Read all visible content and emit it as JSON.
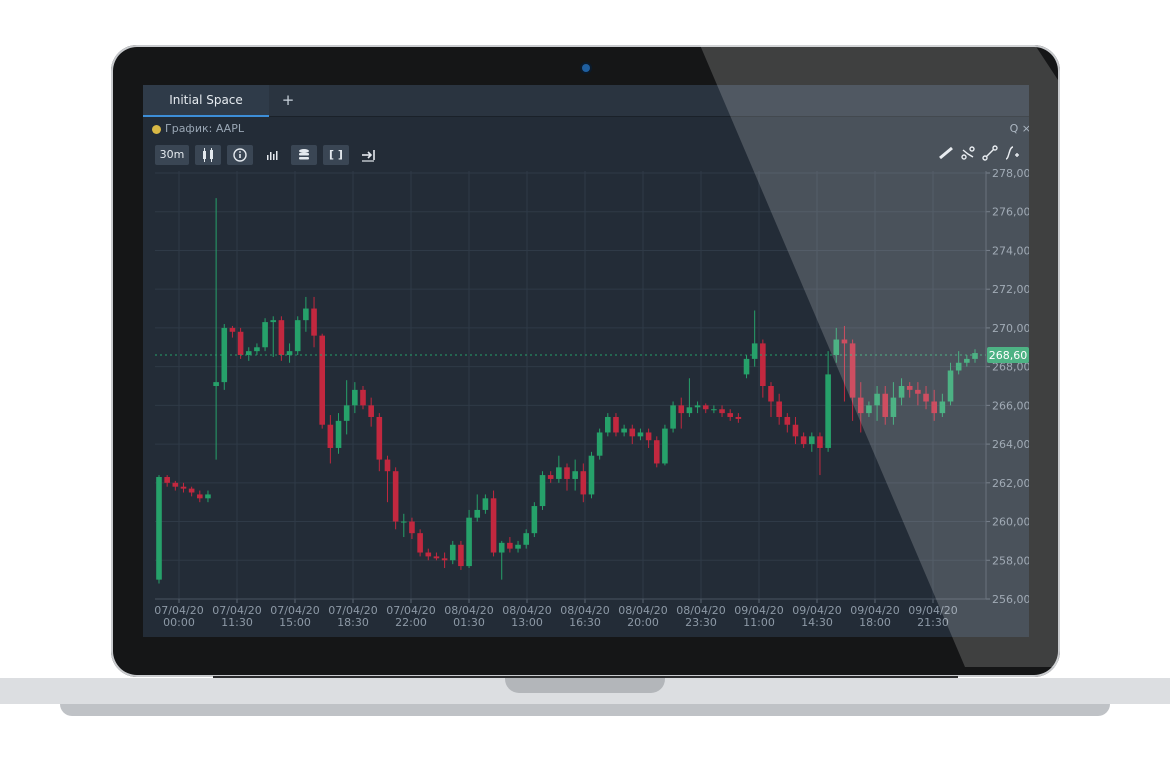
{
  "app": {
    "tabs": [
      {
        "label": "Initial Space"
      }
    ],
    "add_tab": "+",
    "chart_title": "График: AAPL",
    "title_tools": "Q ×",
    "toolbar": {
      "timeframe": "30m",
      "buttons": [
        "candles-icon",
        "info-icon",
        "volume-icon",
        "layers-icon",
        "brackets-icon",
        "arrow-right-bar-icon"
      ],
      "brackets_label": "[ ]"
    },
    "right_tools": [
      "ruler-icon",
      "fib-icon",
      "trend-line-icon",
      "indicator-add-icon"
    ],
    "colors": {
      "up": "#26a16a",
      "down": "#c2283f",
      "bg": "#232c37",
      "price_tag": "#26a16a"
    }
  },
  "chart_data": {
    "type": "candlestick",
    "symbol": "AAPL",
    "title": "График: AAPL",
    "ylim": [
      256,
      278
    ],
    "y_ticks": [
      "278,00",
      "276,00",
      "274,00",
      "272,00",
      "270,00",
      "268,00",
      "266,00",
      "264,00",
      "262,00",
      "260,00",
      "258,00",
      "256,00"
    ],
    "last_price": "268,60",
    "x_ticks": [
      {
        "date": "07/04/20",
        "time": "00:00"
      },
      {
        "date": "07/04/20",
        "time": "11:30"
      },
      {
        "date": "07/04/20",
        "time": "15:00"
      },
      {
        "date": "07/04/20",
        "time": "18:30"
      },
      {
        "date": "07/04/20",
        "time": "22:00"
      },
      {
        "date": "08/04/20",
        "time": "01:30"
      },
      {
        "date": "08/04/20",
        "time": "13:00"
      },
      {
        "date": "08/04/20",
        "time": "16:30"
      },
      {
        "date": "08/04/20",
        "time": "20:00"
      },
      {
        "date": "08/04/20",
        "time": "23:30"
      },
      {
        "date": "09/04/20",
        "time": "11:00"
      },
      {
        "date": "09/04/20",
        "time": "14:30"
      },
      {
        "date": "09/04/20",
        "time": "18:00"
      },
      {
        "date": "09/04/20",
        "time": "21:30"
      }
    ],
    "candles": [
      [
        257,
        262.3,
        256.8,
        262.4
      ],
      [
        262.3,
        262,
        261.8,
        262.4
      ],
      [
        262,
        261.8,
        261.6,
        262.1
      ],
      [
        261.8,
        261.7,
        261.5,
        262
      ],
      [
        261.7,
        261.5,
        261.3,
        261.8
      ],
      [
        261.4,
        261.2,
        261,
        261.6
      ],
      [
        261.2,
        261.4,
        261,
        261.6
      ],
      [
        267.0,
        267.2,
        263.2,
        276.7
      ],
      [
        267.2,
        270.0,
        266.8,
        270.2
      ],
      [
        270.0,
        269.8,
        269.5,
        270.1
      ],
      [
        269.8,
        268.6,
        268.4,
        270
      ],
      [
        268.6,
        268.8,
        268.3,
        269.0
      ],
      [
        268.8,
        269.0,
        268.6,
        269.2
      ],
      [
        269.0,
        270.3,
        268.8,
        270.5
      ],
      [
        270.3,
        270.4,
        268.5,
        270.6
      ],
      [
        270.4,
        268.6,
        268.3,
        270.6
      ],
      [
        268.6,
        268.8,
        268.2,
        269.2
      ],
      [
        268.8,
        270.4,
        268.6,
        270.6
      ],
      [
        270.4,
        271.0,
        269.8,
        271.6
      ],
      [
        271.0,
        269.6,
        269.0,
        271.6
      ],
      [
        269.6,
        265.0,
        264.8,
        269.7
      ],
      [
        265.0,
        263.8,
        263.0,
        265.5
      ],
      [
        263.8,
        265.2,
        263.5,
        265.6
      ],
      [
        265.2,
        266.0,
        264.5,
        267.3
      ],
      [
        266.0,
        266.8,
        265.6,
        267.2
      ],
      [
        266.8,
        266.0,
        265.8,
        267.0
      ],
      [
        266.0,
        265.4,
        264.9,
        266.4
      ],
      [
        265.4,
        263.2,
        262.6,
        265.6
      ],
      [
        263.2,
        262.6,
        261.0,
        263.4
      ],
      [
        262.6,
        260.0,
        259.6,
        262.8
      ],
      [
        260.0,
        260.0,
        259.2,
        260.4
      ],
      [
        260.0,
        259.4,
        259.1,
        260.2
      ],
      [
        259.4,
        258.4,
        258.2,
        259.6
      ],
      [
        258.4,
        258.2,
        258.0,
        258.6
      ],
      [
        258.2,
        258.1,
        258.0,
        258.4
      ],
      [
        258.1,
        258.0,
        257.6,
        258.4
      ],
      [
        258.0,
        258.8,
        257.8,
        259.0
      ],
      [
        258.8,
        257.7,
        257.5,
        259.0
      ],
      [
        257.7,
        260.2,
        257.6,
        260.6
      ],
      [
        260.2,
        260.6,
        260.0,
        261.4
      ],
      [
        260.6,
        261.2,
        260.4,
        261.4
      ],
      [
        261.2,
        258.4,
        258.2,
        261.6
      ],
      [
        258.4,
        258.9,
        257.0,
        259.0
      ],
      [
        258.9,
        258.6,
        258.4,
        259.2
      ],
      [
        258.6,
        258.8,
        258.4,
        259.0
      ],
      [
        258.8,
        259.4,
        258.6,
        259.6
      ],
      [
        259.4,
        260.8,
        259.2,
        261.0
      ],
      [
        260.8,
        262.4,
        260.6,
        262.6
      ],
      [
        262.4,
        262.2,
        262.0,
        262.6
      ],
      [
        262.2,
        262.8,
        262.0,
        263.4
      ],
      [
        262.8,
        262.2,
        261.6,
        263.0
      ],
      [
        262.2,
        262.6,
        261.6,
        263.2
      ],
      [
        262.6,
        261.4,
        261.0,
        263.0
      ],
      [
        261.4,
        263.4,
        261.2,
        263.6
      ],
      [
        263.4,
        264.6,
        263.2,
        264.8
      ],
      [
        264.6,
        265.4,
        264.4,
        265.6
      ],
      [
        265.4,
        264.6,
        264.4,
        265.6
      ],
      [
        264.6,
        264.8,
        264.4,
        265.0
      ],
      [
        264.8,
        264.4,
        264.0,
        265.0
      ],
      [
        264.4,
        264.6,
        264.2,
        264.8
      ],
      [
        264.6,
        264.2,
        263.8,
        264.8
      ],
      [
        264.2,
        263.0,
        262.8,
        264.4
      ],
      [
        263.0,
        264.8,
        262.9,
        265.0
      ],
      [
        264.8,
        266.0,
        264.6,
        266.2
      ],
      [
        266.0,
        265.6,
        264.8,
        266.4
      ],
      [
        265.6,
        265.9,
        265.4,
        267.4
      ],
      [
        265.9,
        266.0,
        265.6,
        266.2
      ],
      [
        266.0,
        265.8,
        265.6,
        266.1
      ],
      [
        265.8,
        265.8,
        265.6,
        266.0
      ],
      [
        265.8,
        265.6,
        265.4,
        266.0
      ],
      [
        265.6,
        265.4,
        265.2,
        265.8
      ],
      [
        265.4,
        265.3,
        265.1,
        265.6
      ],
      [
        267.6,
        268.4,
        267.4,
        268.6
      ],
      [
        268.4,
        269.2,
        268.0,
        270.9
      ],
      [
        269.2,
        267.0,
        266.4,
        269.4
      ],
      [
        267.0,
        266.2,
        265.4,
        267.2
      ],
      [
        266.2,
        265.4,
        265.0,
        266.6
      ],
      [
        265.4,
        265.0,
        264.6,
        265.6
      ],
      [
        265.0,
        264.4,
        264.0,
        265.4
      ],
      [
        264.4,
        264.0,
        263.8,
        264.6
      ],
      [
        264.0,
        264.4,
        263.6,
        264.6
      ],
      [
        264.4,
        263.8,
        262.4,
        264.6
      ],
      [
        263.8,
        267.6,
        263.6,
        268.8
      ],
      [
        268.6,
        269.4,
        268.2,
        270.0
      ],
      [
        269.4,
        269.2,
        266.2,
        270.1
      ],
      [
        269.2,
        266.4,
        265.2,
        269.4
      ],
      [
        266.4,
        265.6,
        264.6,
        267.2
      ],
      [
        265.6,
        266.0,
        265.4,
        266.2
      ],
      [
        266.0,
        266.6,
        265.2,
        267.0
      ],
      [
        266.6,
        265.4,
        265.0,
        267.0
      ],
      [
        265.4,
        266.4,
        265.0,
        267.2
      ],
      [
        266.4,
        267.0,
        266.0,
        267.4
      ],
      [
        267.0,
        266.8,
        266.4,
        267.2
      ],
      [
        266.8,
        266.6,
        266.0,
        267.2
      ],
      [
        266.6,
        266.2,
        265.8,
        267.0
      ],
      [
        266.2,
        265.6,
        265.2,
        266.8
      ],
      [
        265.6,
        266.2,
        265.4,
        266.6
      ],
      [
        266.2,
        267.8,
        266.0,
        268.2
      ],
      [
        267.8,
        268.2,
        267.6,
        268.8
      ],
      [
        268.2,
        268.4,
        268.0,
        268.6
      ],
      [
        268.4,
        268.7,
        268.2,
        268.9
      ]
    ]
  }
}
